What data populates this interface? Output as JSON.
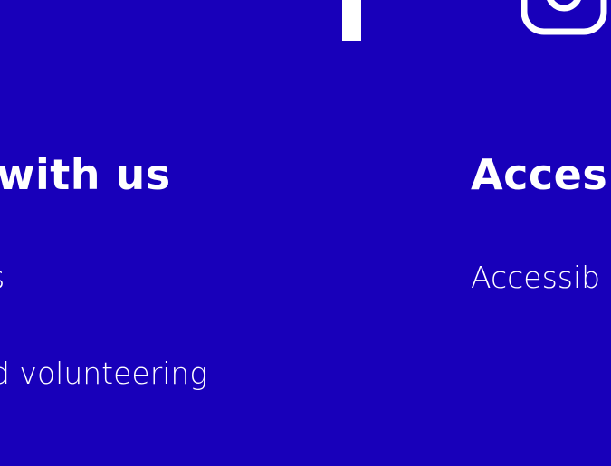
{
  "social": {
    "facebook_icon": "facebook-icon",
    "instagram_icon": "instagram-icon"
  },
  "columns": {
    "work": {
      "heading": "with us",
      "links": [
        {
          "label": "s"
        },
        {
          "label": "d volunteering"
        }
      ]
    },
    "access": {
      "heading": "Acces",
      "links": [
        {
          "label": "Accessib"
        }
      ]
    }
  },
  "colors": {
    "background": "#1800BA",
    "foreground": "#FFFFFF"
  }
}
